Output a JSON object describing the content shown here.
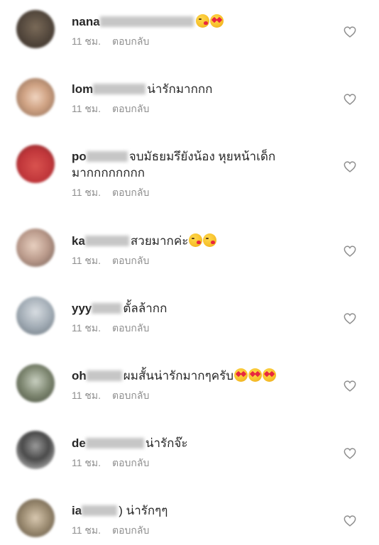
{
  "comments": [
    {
      "username": "nana",
      "text": "",
      "emojis": [
        "kiss",
        "heart-eyes"
      ],
      "time": "11 ชม.",
      "reply": "ตอบกลับ",
      "avatar_color": "#5a4e44"
    },
    {
      "username": "lom",
      "text": "น่ารักมากกก",
      "emojis": [],
      "time": "11 ชม.",
      "reply": "ตอบกลับ",
      "avatar_color": "#c9a386"
    },
    {
      "username": "po",
      "text": "จบมัธยมรึยังน้อง  หุยหน้าเด็ก",
      "text2": "มากกกกกกกก",
      "emojis": [],
      "time": "11 ชม.",
      "reply": "ตอบกลับ",
      "avatar_color": "#c93a3f"
    },
    {
      "username": "ka",
      "text": "สวยมากค่ะ",
      "emojis": [
        "kiss",
        "kiss"
      ],
      "time": "11 ชม.",
      "reply": "ตอบกลับ",
      "avatar_color": "#b89a88"
    },
    {
      "username": "yyy",
      "text": "ตั้ลล้ากก",
      "emojis": [],
      "time": "11 ชม.",
      "reply": "ตอบกลับ",
      "avatar_color": "#a6b0b8"
    },
    {
      "username": "oh",
      "text": "ผมสั้นน่ารักมากๆครับ",
      "emojis": [
        "heart-eyes",
        "heart-eyes",
        "heart-eyes"
      ],
      "time": "11 ชม.",
      "reply": "ตอบกลับ",
      "avatar_color": "#6d7560"
    },
    {
      "username": "de",
      "text": "น่ารักจ๊ะ",
      "emojis": [],
      "time": "11 ชม.",
      "reply": "ตอบกลับ",
      "avatar_color": "#4a4a4a"
    },
    {
      "username": "ia",
      "text": ") น่ารักๆๆ",
      "emojis": [],
      "time": "11 ชม.",
      "reply": "ตอบกลับ",
      "avatar_color": "#9a8a70"
    }
  ]
}
